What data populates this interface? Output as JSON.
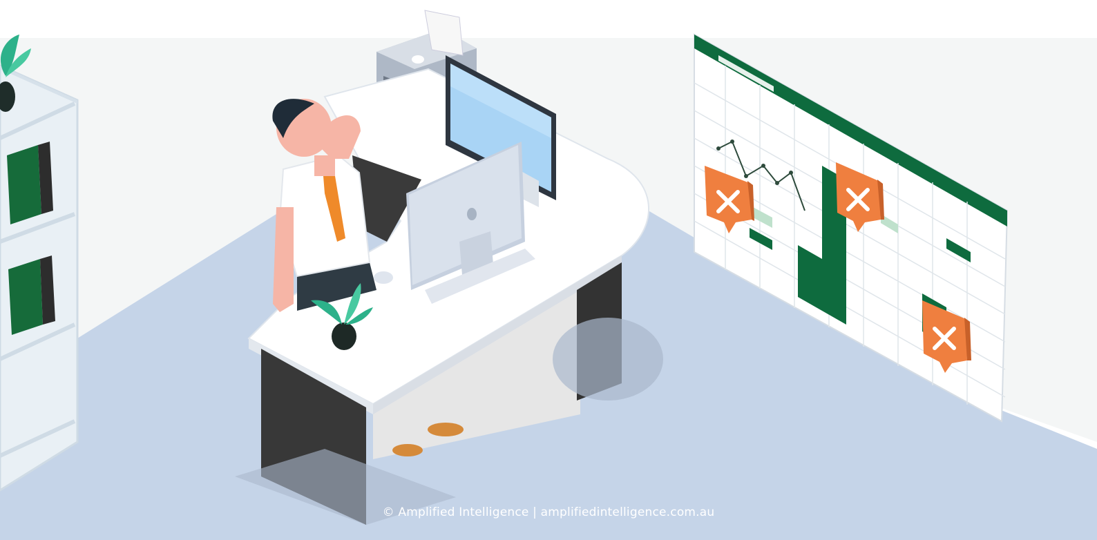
{
  "footer": {
    "copyright": "© Amplified Intelligence",
    "separator": " | ",
    "url": "amplifiedintelligence.com.au"
  },
  "scene": {
    "icons": [
      "potted-plant-icon",
      "printer-icon",
      "monitor-icon",
      "spreadsheet-icon",
      "error-x-icon"
    ],
    "colors": {
      "floor": "#c6d5e9",
      "wall": "#f4f6f7",
      "desk": "#ffffff",
      "desk_legs": "#3a3a3a",
      "sheet_green": "#0e6b3e",
      "error_orange": "#ef7f3f",
      "tie_orange": "#ef8a2a"
    }
  }
}
